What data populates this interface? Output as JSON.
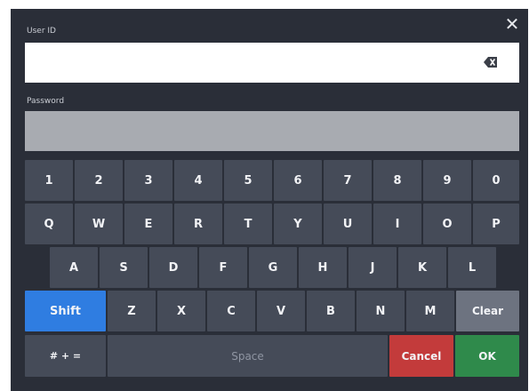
{
  "dialog": {
    "close_glyph": "✕",
    "userid_label": "User ID",
    "userid_value": "",
    "password_label": "Password",
    "password_value": ""
  },
  "keyboard": {
    "row_numbers": [
      "1",
      "2",
      "3",
      "4",
      "5",
      "6",
      "7",
      "8",
      "9",
      "0"
    ],
    "row_top": [
      "Q",
      "W",
      "E",
      "R",
      "T",
      "Y",
      "U",
      "I",
      "O",
      "P"
    ],
    "row_home": [
      "A",
      "S",
      "D",
      "F",
      "G",
      "H",
      "J",
      "K",
      "L"
    ],
    "shift_label": "Shift",
    "row_bottom": [
      "Z",
      "X",
      "C",
      "V",
      "B",
      "N",
      "M"
    ],
    "clear_label": "Clear",
    "symbols_label": "# + =",
    "space_label": "Space",
    "cancel_label": "Cancel",
    "ok_label": "OK"
  },
  "colors": {
    "panel": "#2a2e38",
    "key": "#454b58",
    "shift": "#2f7de1",
    "clear": "#6d7380",
    "cancel": "#c33b3b",
    "ok": "#2f8a4b"
  },
  "icons": {
    "close": "close-icon",
    "backspace": "backspace-icon"
  }
}
